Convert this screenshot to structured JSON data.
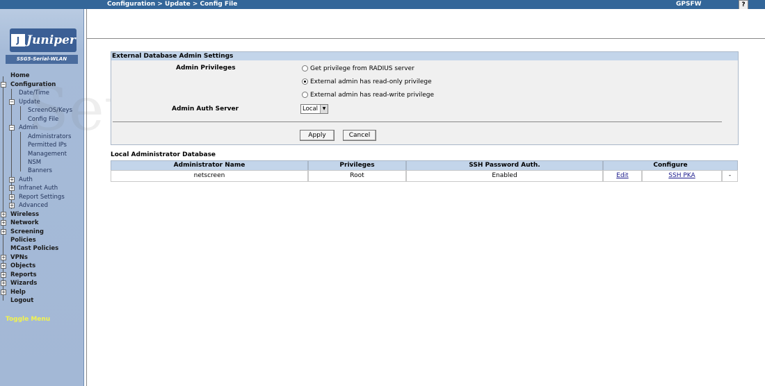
{
  "topbar": {
    "breadcrumb": "Configuration > Update > Config File",
    "device_name": "GPSFW",
    "help_label": "?"
  },
  "sidebar": {
    "logo_text": "Juniper",
    "logo_mark": "J",
    "model": "SSG5-Serial-WLAN",
    "items": [
      {
        "label": "Home"
      },
      {
        "label": "Configuration"
      },
      {
        "label": "Date/Time"
      },
      {
        "label": "Update"
      },
      {
        "label": "ScreenOS/Keys"
      },
      {
        "label": "Config File"
      },
      {
        "label": "Admin"
      },
      {
        "label": "Administrators"
      },
      {
        "label": "Permitted IPs"
      },
      {
        "label": "Management"
      },
      {
        "label": "NSM"
      },
      {
        "label": "Banners"
      },
      {
        "label": "Auth"
      },
      {
        "label": "Infranet Auth"
      },
      {
        "label": "Report Settings"
      },
      {
        "label": "Advanced"
      },
      {
        "label": "Wireless"
      },
      {
        "label": "Network"
      },
      {
        "label": "Screening"
      },
      {
        "label": "Policies"
      },
      {
        "label": "MCast Policies"
      },
      {
        "label": "VPNs"
      },
      {
        "label": "Objects"
      },
      {
        "label": "Reports"
      },
      {
        "label": "Wizards"
      },
      {
        "label": "Help"
      },
      {
        "label": "Logout"
      }
    ],
    "toggle_menu": "Toggle Menu"
  },
  "watermark": "SetupRouter.com",
  "external_db": {
    "title": "External Database Admin Settings",
    "admin_privileges_label": "Admin Privileges",
    "options": [
      {
        "label": "Get privilege from RADIUS server",
        "selected": false
      },
      {
        "label": "External admin has read-only privilege",
        "selected": true
      },
      {
        "label": "External admin has read-write privilege",
        "selected": false
      }
    ],
    "auth_server_label": "Admin Auth Server",
    "auth_server_value": "Local",
    "apply_label": "Apply",
    "cancel_label": "Cancel"
  },
  "local_db": {
    "title": "Local Administrator Database",
    "columns": [
      "Administrator Name",
      "Privileges",
      "SSH Password Auth.",
      "Configure"
    ],
    "rows": [
      {
        "name": "netscreen",
        "privilege": "Root",
        "ssh_auth": "Enabled",
        "edit": "Edit",
        "ssh_pka": "SSH PKA",
        "remove": "-"
      }
    ]
  }
}
